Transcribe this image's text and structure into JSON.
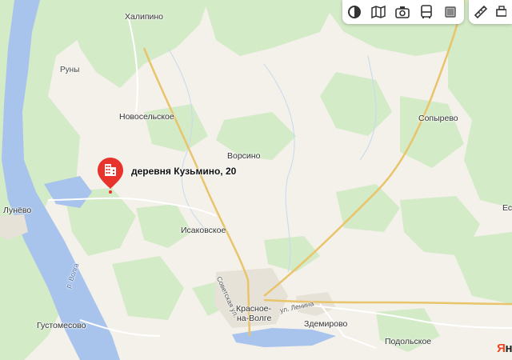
{
  "map": {
    "pin_label": "деревня Кузьмино, 20",
    "places": {
      "halipino": "Халипино",
      "runy": "Руны",
      "novoselskoe": "Новосельское",
      "sopyrevo": "Сопырево",
      "vorsino": "Ворсино",
      "lunevo": "Лунёво",
      "isakovskoe": "Исаковское",
      "krasnoe_line1": "Красное-",
      "krasnoe_line2": "на-Волге",
      "zdemirovo": "Здемирово",
      "gustomesovo": "Густомесово",
      "podolskoe": "Подольское",
      "edge_right": "Ес"
    },
    "streets": {
      "sovetskaya": "Советская ул.",
      "lenina": "ул. Ленина",
      "river": "р. Волга"
    },
    "brand": {
      "part1": "Я",
      "part2": "н"
    }
  },
  "toolbar": {
    "layers_icon": "layers-icon",
    "panorama_icon": "panorama-icon",
    "photo_icon": "camera-icon",
    "transit_icon": "bus-icon",
    "traffic_icon": "traffic-icon",
    "ruler_icon": "ruler-icon",
    "print_icon": "print-icon"
  },
  "colors": {
    "water": "#a8c4ec",
    "forest": "#d4ebc8",
    "land": "#f3f1ea",
    "road": "#f5d98f",
    "pin": "#e8322c"
  }
}
